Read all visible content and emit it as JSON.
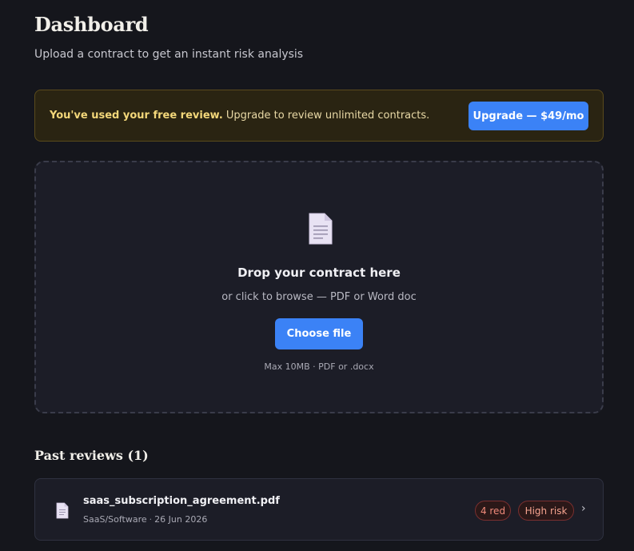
{
  "header": {
    "title": "Dashboard",
    "subtitle": "Upload a contract to get an instant risk analysis"
  },
  "banner": {
    "bold_text": "You've used your free review.",
    "text": " Upgrade to review unlimited contracts.",
    "button_label": "Upgrade — $49/mo"
  },
  "dropzone": {
    "icon": "document-icon",
    "title": "Drop your contract here",
    "subtitle": "or click to browse — PDF or Word doc",
    "button_label": "Choose file",
    "note": "Max 10MB · PDF or .docx"
  },
  "past_reviews": {
    "title": "Past reviews (1)",
    "items": [
      {
        "icon": "document-icon",
        "file_name": "saas_subscription_agreement.pdf",
        "category": "SaaS/Software",
        "separator": "·",
        "date": "26 Jun 2026",
        "flag_count": "4 red",
        "risk_level": "High risk",
        "chevron": "›"
      }
    ]
  },
  "colors": {
    "accent": "#3b82f6",
    "banner_bg": "#2a2412",
    "risk_red": "#f08a7a",
    "background": "#15161c"
  }
}
